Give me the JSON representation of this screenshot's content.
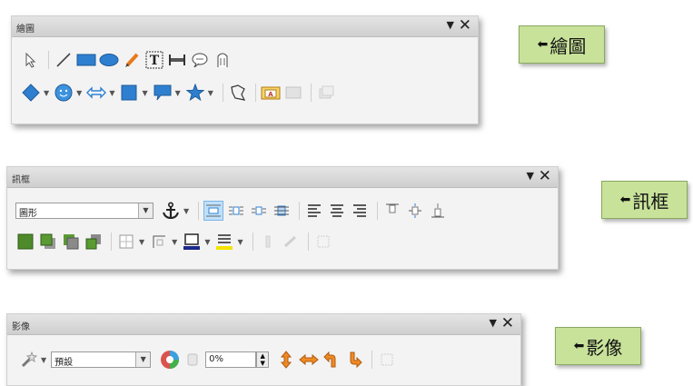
{
  "toolbars": {
    "drawing": {
      "title": "繪圖",
      "menu_icon": "▼",
      "close_icon": "✕"
    },
    "frame": {
      "title": "訊框",
      "menu_icon": "▼",
      "close_icon": "✕",
      "style_combo": "圖形"
    },
    "image": {
      "title": "影像",
      "menu_icon": "▼",
      "close_icon": "✕",
      "mode_combo": "預設",
      "transparency_value": "0%"
    }
  },
  "callouts": {
    "drawing": "繪圖",
    "frame": "訊框",
    "image": "影像",
    "arrow_glyph": "◆"
  },
  "colors": {
    "blue_shape": "#2f7fd0",
    "callout_bg": "#c8e29a",
    "orange_icon": "#f08a24",
    "toolbar_bg": "#f3f3f3",
    "highlight": "#bfe0fb"
  }
}
